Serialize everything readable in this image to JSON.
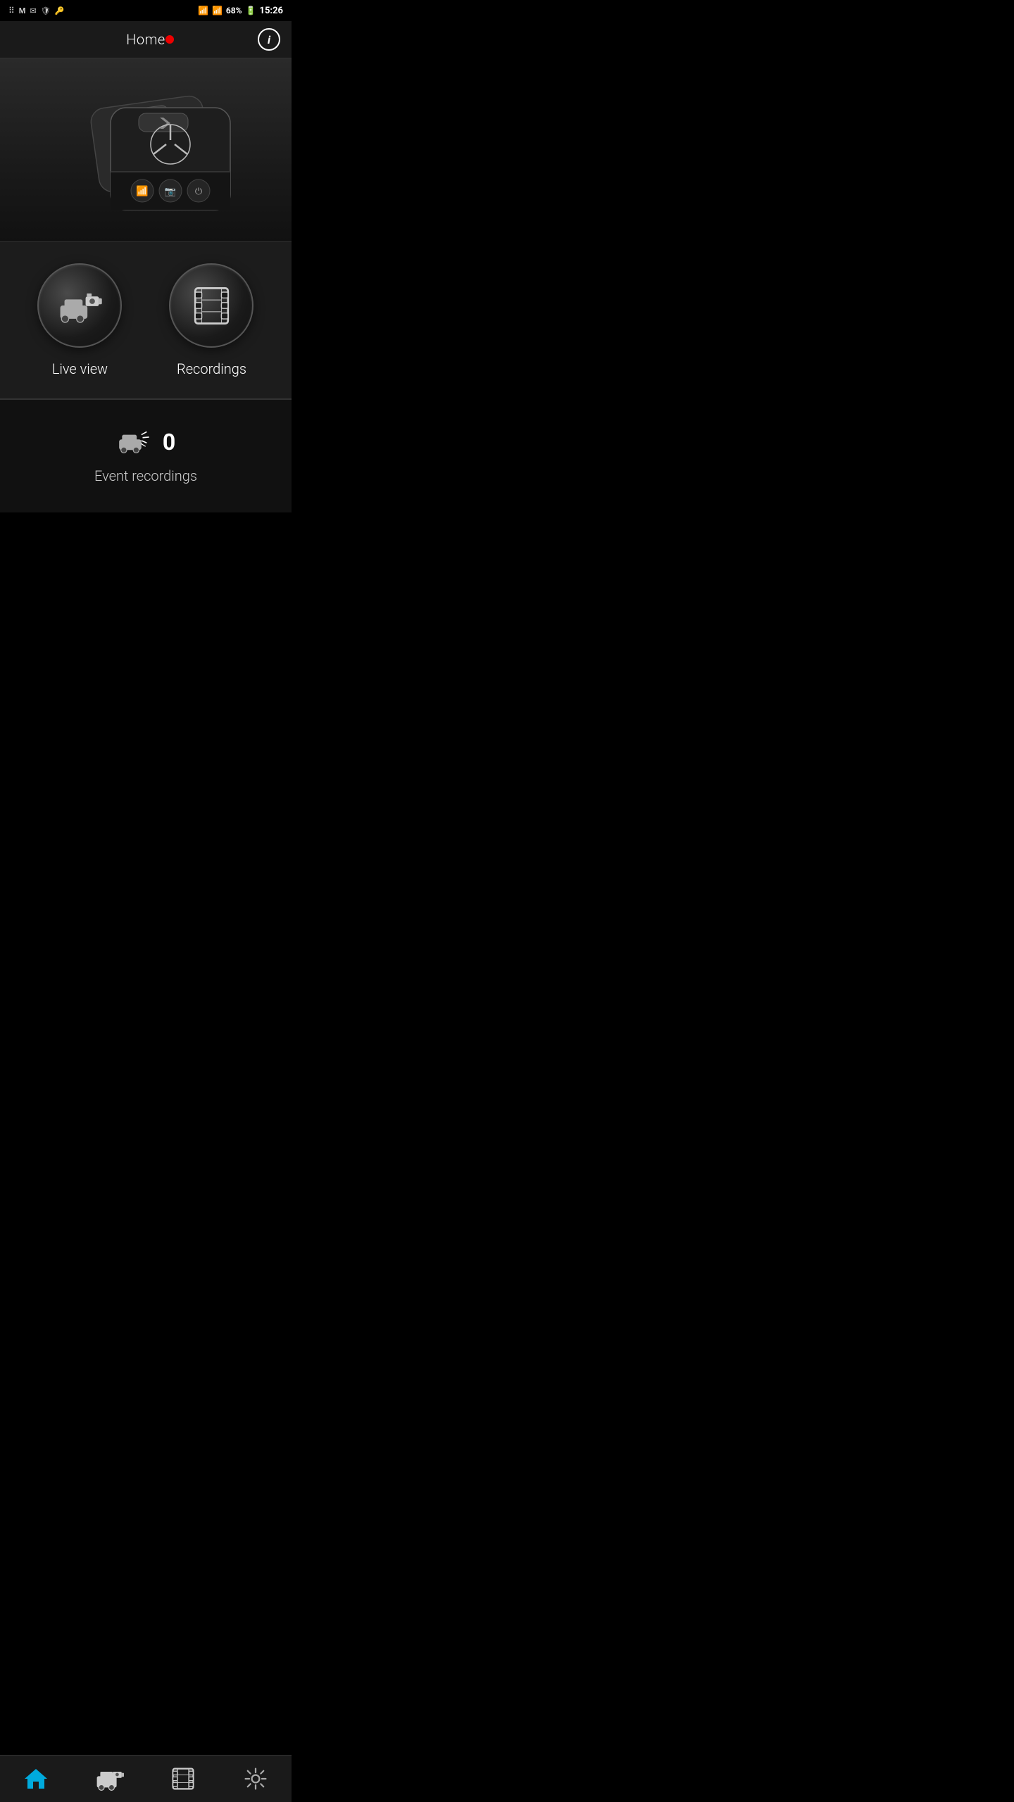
{
  "statusBar": {
    "battery": "68%",
    "time": "15:26",
    "icons": [
      "dots",
      "gmail",
      "mail2",
      "shield",
      "key"
    ]
  },
  "header": {
    "title": "Home",
    "infoButton": "i"
  },
  "actions": [
    {
      "id": "live-view",
      "label": "Live view",
      "icon": "camera-car-icon"
    },
    {
      "id": "recordings",
      "label": "Recordings",
      "icon": "film-strip-icon"
    }
  ],
  "eventSection": {
    "count": "0",
    "label": "Event recordings"
  },
  "bottomNav": [
    {
      "id": "home",
      "icon": "home-icon",
      "active": true
    },
    {
      "id": "live",
      "icon": "live-icon",
      "active": false
    },
    {
      "id": "recordings",
      "icon": "film-icon",
      "active": false
    },
    {
      "id": "settings",
      "icon": "gear-icon",
      "active": false
    }
  ]
}
